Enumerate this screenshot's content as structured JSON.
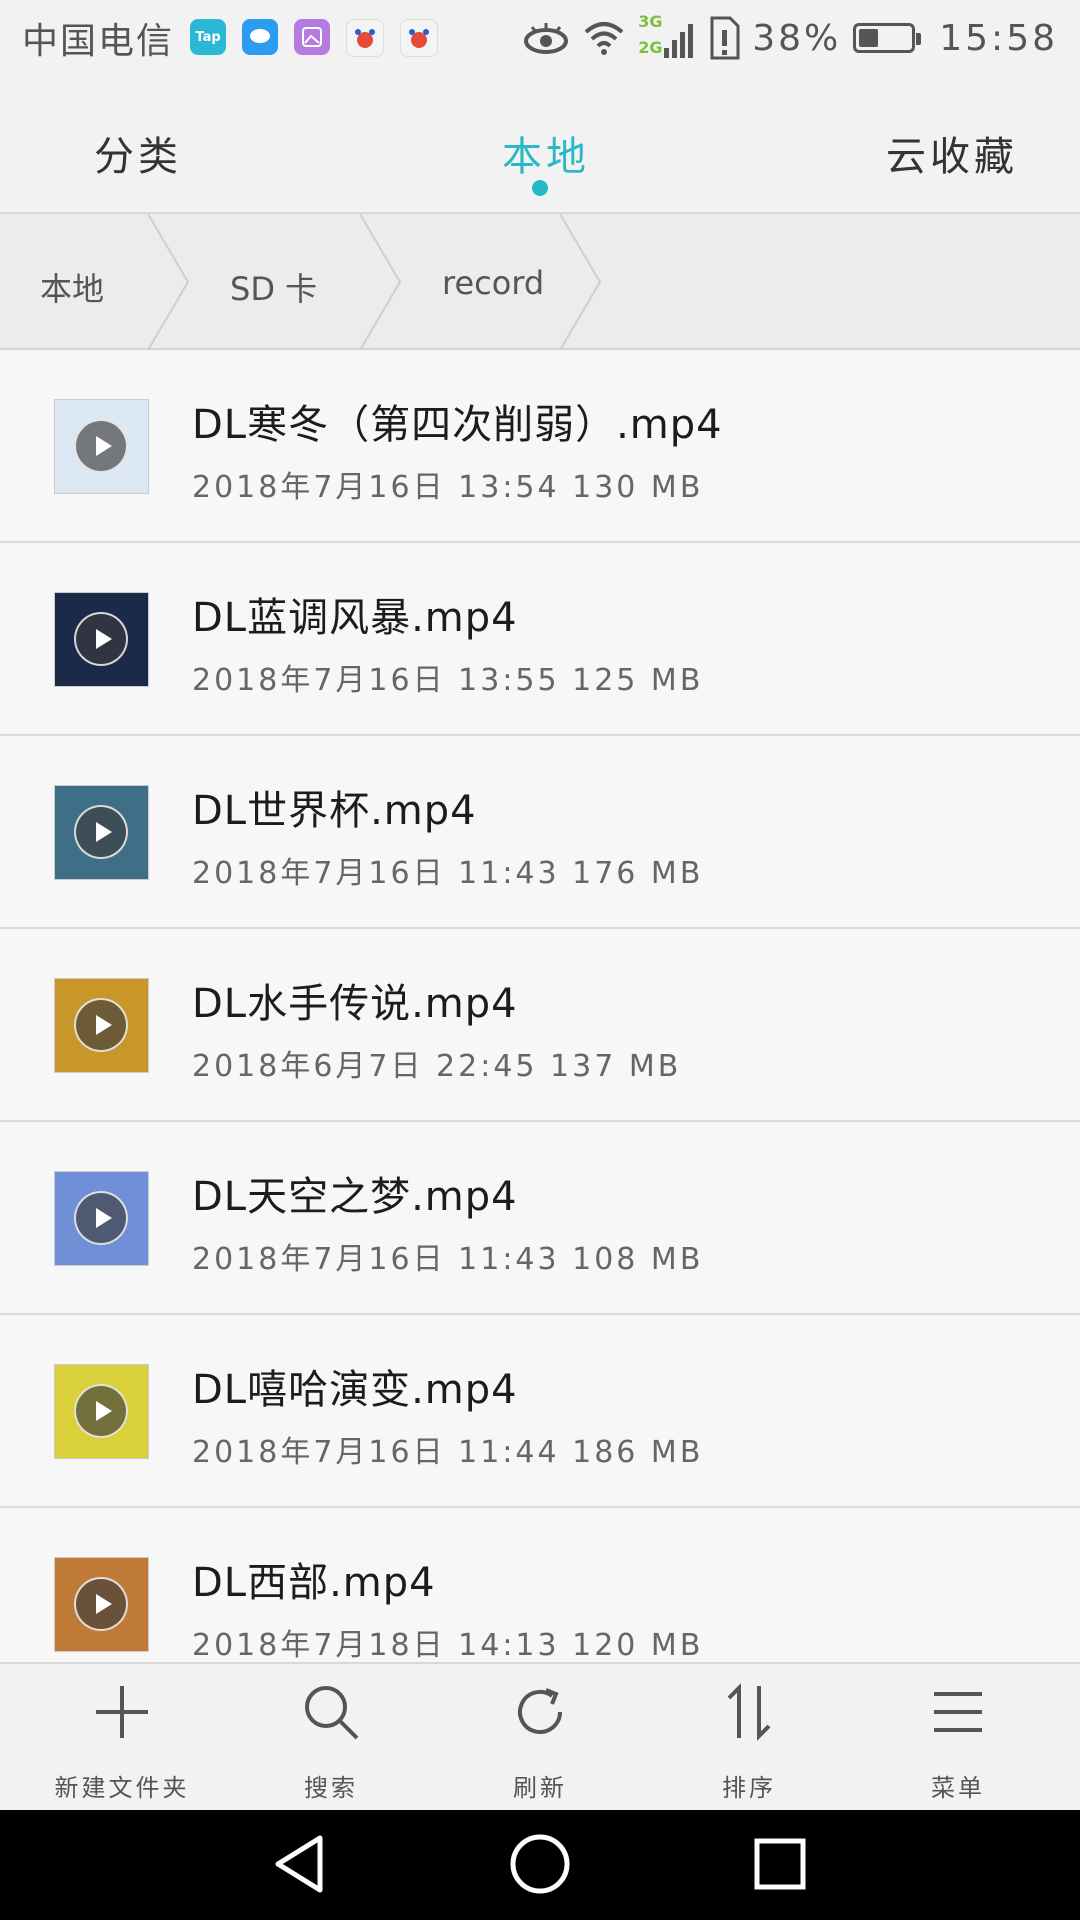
{
  "status_bar": {
    "carrier": "中国电信",
    "notification_icons": [
      "taptap-icon",
      "message-icon",
      "gallery-icon",
      "baidu-icon",
      "baidu-icon"
    ],
    "tap_label": "Tap",
    "network_label_top": "3G",
    "network_label_bottom": "2G",
    "battery_percent": "38%",
    "battery_level": 0.38,
    "time": "15:58"
  },
  "tabs": [
    {
      "label": "分类",
      "active": false
    },
    {
      "label": "本地",
      "active": true
    },
    {
      "label": "云收藏",
      "active": false
    }
  ],
  "breadcrumb": [
    "本地",
    "SD 卡",
    "record"
  ],
  "files": [
    {
      "name": "DL寒冬（第四次削弱）.mp4",
      "meta": "2018年7月16日 13:54 130 MB",
      "thumb_color": "#dde8f5"
    },
    {
      "name": "DL蓝调风暴.mp4",
      "meta": "2018年7月16日 13:55 125 MB",
      "thumb_color": "#1c2a4a"
    },
    {
      "name": "DL世界杯.mp4",
      "meta": "2018年7月16日 11:43 176 MB",
      "thumb_color": "#3f6f86"
    },
    {
      "name": "DL水手传说.mp4",
      "meta": "2018年6月7日 22:45 137 MB",
      "thumb_color": "#c9962a"
    },
    {
      "name": "DL天空之梦.mp4",
      "meta": "2018年7月16日 11:43 108 MB",
      "thumb_color": "#6f8fd6"
    },
    {
      "name": "DL嘻哈演变.mp4",
      "meta": "2018年7月16日 11:44 186 MB",
      "thumb_color": "#d9d03a"
    },
    {
      "name": "DL西部.mp4",
      "meta": "2018年7月18日 14:13 120 MB",
      "thumb_color": "#c07a38"
    }
  ],
  "toolbar": {
    "new_folder": "新建文件夹",
    "search": "搜索",
    "refresh": "刷新",
    "sort": "排序",
    "menu": "菜单"
  },
  "colors": {
    "accent": "#2ab8c5"
  }
}
